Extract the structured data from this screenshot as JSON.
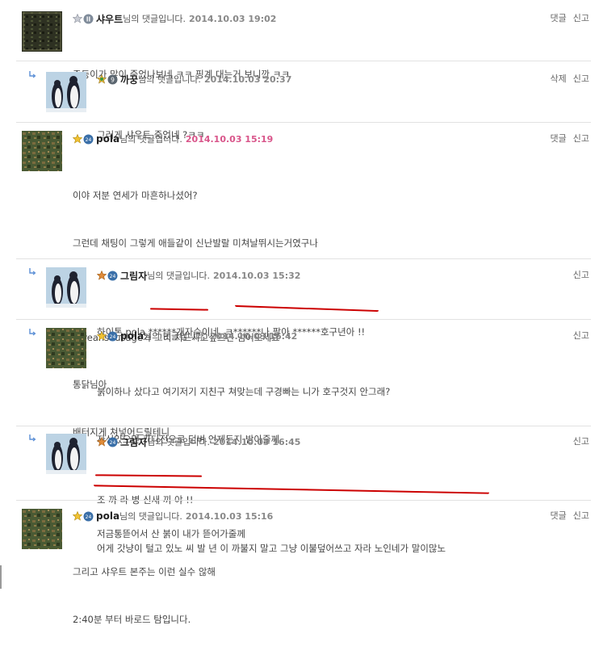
{
  "suffix": "님의 댓글입니다.",
  "comments": [
    {
      "nick": "샤우트",
      "date": "2014.10.03 19:02",
      "actions": [
        "댓글",
        "신고"
      ],
      "lines": [
        "주둥이가 많이 죽었나보네 ㅋㅋ 핑계 대는거 보니깐 ㅋㅋ"
      ]
    },
    {
      "nick": "까꿍",
      "date": "2014.10.03 20:37",
      "actions": [
        "삭제",
        "신고"
      ],
      "lines": [
        "그러게 샤우트 죽었네 ?ㅋㅋ"
      ]
    },
    {
      "nick": "pola",
      "date": "2014.10.03 15:19",
      "actions": [
        "댓글",
        "신고"
      ],
      "lines": [
        "이야 저분 연세가 마흔하나셨어?",
        "그런데 채팅이 그렇게 애들같이 신난발랄 미쳐날뛰시는거였구나",
        "",
        "koreansausage가 그리 처드시고싶으면 넘어오세요",
        "통닭님아",
        "배터지게 쳐넣어드릴테니"
      ]
    },
    {
      "nick": "그림자",
      "date": "2014.10.03 15:32",
      "actions": [
        "신고"
      ],
      "lines": [
        "하이톤 pola ******개자슥이네  ㅋ******나 팔아 ******호구년아 !!"
      ]
    },
    {
      "nick": "pola",
      "date": "2014.10.03 16:42",
      "actions": [
        "신고"
      ],
      "lines": [
        "붉이하나 샀다고 여기저기 지친구 쳐맞는데 구경빠는 니가 호구것지 안그래?",
        "자신있으면 카다전으로 덤벼 언제든지 받아줄께",
        "",
        "저금통뜯어서 산 붉이 내가 뜯어가줄께"
      ]
    },
    {
      "nick": "그림자",
      "date": "2014.10.03 16:45",
      "actions": [
        "신고"
      ],
      "lines": [
        "조 까 라 병 신새 끼 야 !!",
        "어게 갓냥이 털고 있노 씨 발 년 이 까불지 말고 그냥 이불덮어쓰고 자라 노인네가 말이많노"
      ]
    },
    {
      "nick": "pola",
      "date": "2014.10.03 15:16",
      "actions": [
        "댓글",
        "신고"
      ],
      "lines": [
        "그리고 샤우트 본주는 이런 실수 않해",
        "2:40분 부터 바로드 탐입니다."
      ]
    }
  ],
  "colors": {
    "date_highlight": "#d9558a",
    "underline": "#cc0000"
  }
}
